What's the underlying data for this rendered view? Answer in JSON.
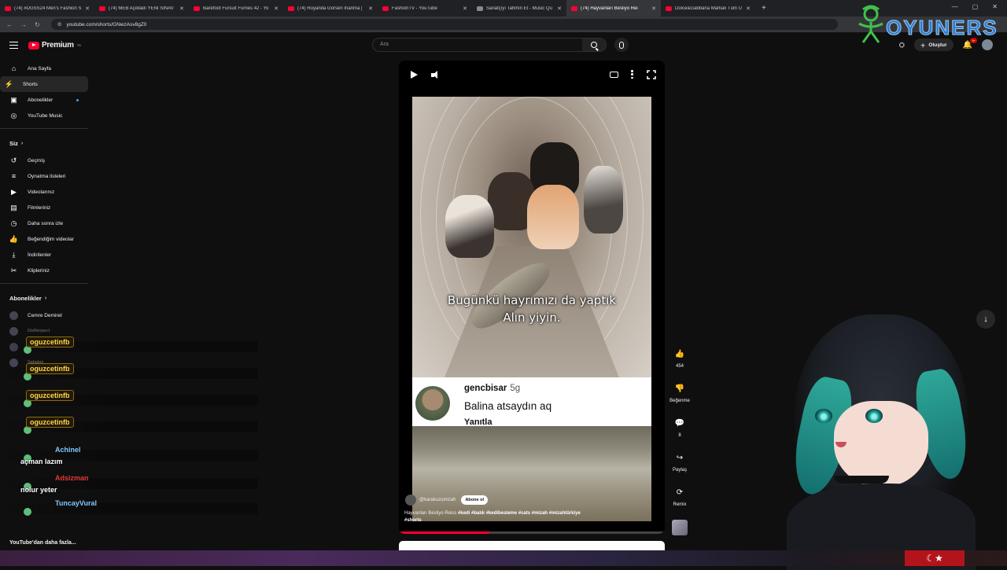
{
  "tabs": [
    {
      "title": "(74) #DGSS24 Men's Fashion S",
      "type": "yt"
    },
    {
      "title": "(74) MEB Açıkladı YENİ SINAV",
      "type": "yt"
    },
    {
      "title": "Barefoot Fursuit Furries 42 - Yo",
      "type": "yt"
    },
    {
      "title": "(74) Rüyanda Görsen İnanma |",
      "type": "yt"
    },
    {
      "title": "FashionTV - YouTube",
      "type": "yt"
    },
    {
      "title": "Sanatçıyı Tahmin Et - Music Qu",
      "type": "music"
    },
    {
      "title": "(74) Hayvanları Besliyo Rei",
      "type": "yt",
      "active": true
    },
    {
      "title": "Dolce&Gabbana Markalı Tüm Ü",
      "type": "yt"
    }
  ],
  "browser": {
    "url": "youtube.com/shorts/GNwzAsv8gZ0"
  },
  "header": {
    "logo_text": "Premium",
    "logo_sup": "TR",
    "search_placeholder": "Ara",
    "create_label": "Oluştur",
    "notif_badge": "9+"
  },
  "brand": {
    "word": "OYUNERS"
  },
  "sidebar": {
    "main": [
      {
        "label": "Ana Sayfa",
        "icon": "home-icon",
        "glyph": "⌂"
      },
      {
        "label": "Shorts",
        "icon": "shorts-icon",
        "glyph": "⚡",
        "active": true
      },
      {
        "label": "Abonelikler",
        "icon": "subscriptions-icon",
        "glyph": "▣"
      },
      {
        "label": "YouTube Music",
        "icon": "music-icon",
        "glyph": "◎"
      }
    ],
    "you_title": "Siz",
    "you": [
      {
        "label": "Geçmiş",
        "icon": "history-icon",
        "glyph": "↺"
      },
      {
        "label": "Oynatma listeleri",
        "icon": "playlist-icon",
        "glyph": "≡"
      },
      {
        "label": "Videolarınız",
        "icon": "your-videos-icon",
        "glyph": "▶"
      },
      {
        "label": "Filmleriniz",
        "icon": "movies-icon",
        "glyph": "▤"
      },
      {
        "label": "Daha sonra izle",
        "icon": "watch-later-icon",
        "glyph": "◷"
      },
      {
        "label": "Beğendiğim videolar",
        "icon": "liked-icon",
        "glyph": "👍"
      },
      {
        "label": "İndirilenler",
        "icon": "download-icon",
        "glyph": "⤓"
      },
      {
        "label": "Klipleriniz",
        "icon": "clips-icon",
        "glyph": "✂"
      }
    ],
    "subs_title": "Abonelikler",
    "subs": [
      {
        "label": "Cemre Demirel"
      },
      {
        "label": "DisRespect"
      },
      {
        "label": "Muhteşem Yüzyıl"
      },
      {
        "label": "Sabaton"
      }
    ],
    "more_label": "YouTube'dan daha fazla..."
  },
  "chat": [
    {
      "name": "oguzcetinfb",
      "style": "gold"
    },
    {
      "name": "oguzcetinfb",
      "style": "gold"
    },
    {
      "name": "oguzcetinfb",
      "style": "gold"
    },
    {
      "name": "oguzcetinfb",
      "style": "gold"
    },
    {
      "name": "Achinel",
      "style": "blue-badged",
      "message": "açman lazım"
    },
    {
      "name": "Adsizman",
      "style": "red",
      "message": "nolur yeter"
    },
    {
      "name": "TuncayVural",
      "style": "blue"
    }
  ],
  "video": {
    "caption_line1": "Bugünkü hayrımızı da yaptık",
    "caption_line2": "Alın yiyin.",
    "reply_user": "gencbisar",
    "reply_age": "5g",
    "reply_text": "Balina atsaydın aq",
    "reply_action": "Yanıtla",
    "channel": "@karakuzumizah",
    "subscribe": "Abone ol",
    "desc_plain": "Hayvanları Besliyo Reiss",
    "desc_tags": "#kedi #balık #kedibesleme #cats #mizah #mizahtürkiye #shorts",
    "progress": 0.34
  },
  "actions": {
    "like_count": "454",
    "dislike_label": "Beğenme",
    "comments_count": "8",
    "share_label": "Paylaş",
    "remix_label": "Remix"
  },
  "colors": {
    "accent": "#ff0033",
    "link": "#3ea6ff",
    "bg": "#0f0f0f"
  }
}
